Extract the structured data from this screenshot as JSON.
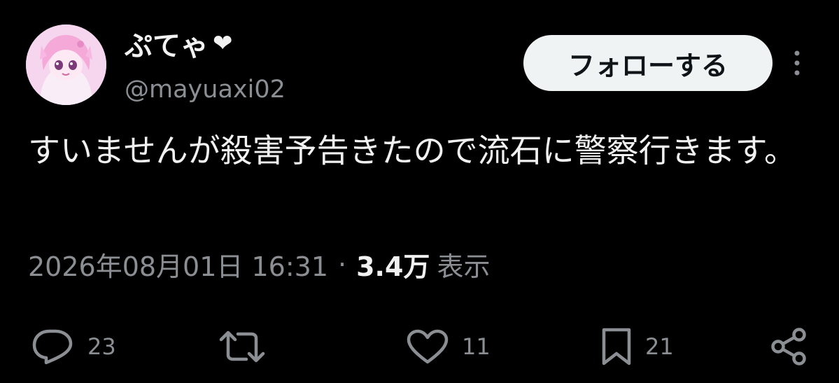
{
  "author": {
    "display_name": "ぷてゃ",
    "handle": "@mayuaxi02",
    "avatar_icon": "anime-girl-avatar"
  },
  "follow_button": {
    "label": "フォローする"
  },
  "more_icon": "more-vertical-icon",
  "tweet": {
    "text": "すいませんが殺害予告きたので流石に警察行きます。"
  },
  "meta": {
    "datetime": "2026年08月01日 16:31",
    "separator": "·",
    "views_count": "3.4万",
    "views_label": "表示"
  },
  "actions": {
    "reply": {
      "icon": "reply-icon",
      "count": "23"
    },
    "retweet": {
      "icon": "retweet-icon",
      "count": ""
    },
    "like": {
      "icon": "heart-icon",
      "count": "11"
    },
    "bookmark": {
      "icon": "bookmark-icon",
      "count": "21"
    },
    "share": {
      "icon": "share-icon"
    }
  },
  "colors": {
    "background": "#000000",
    "text": "#e7e9ea",
    "secondary": "#8b8f94",
    "button_bg": "#eff3f4"
  }
}
